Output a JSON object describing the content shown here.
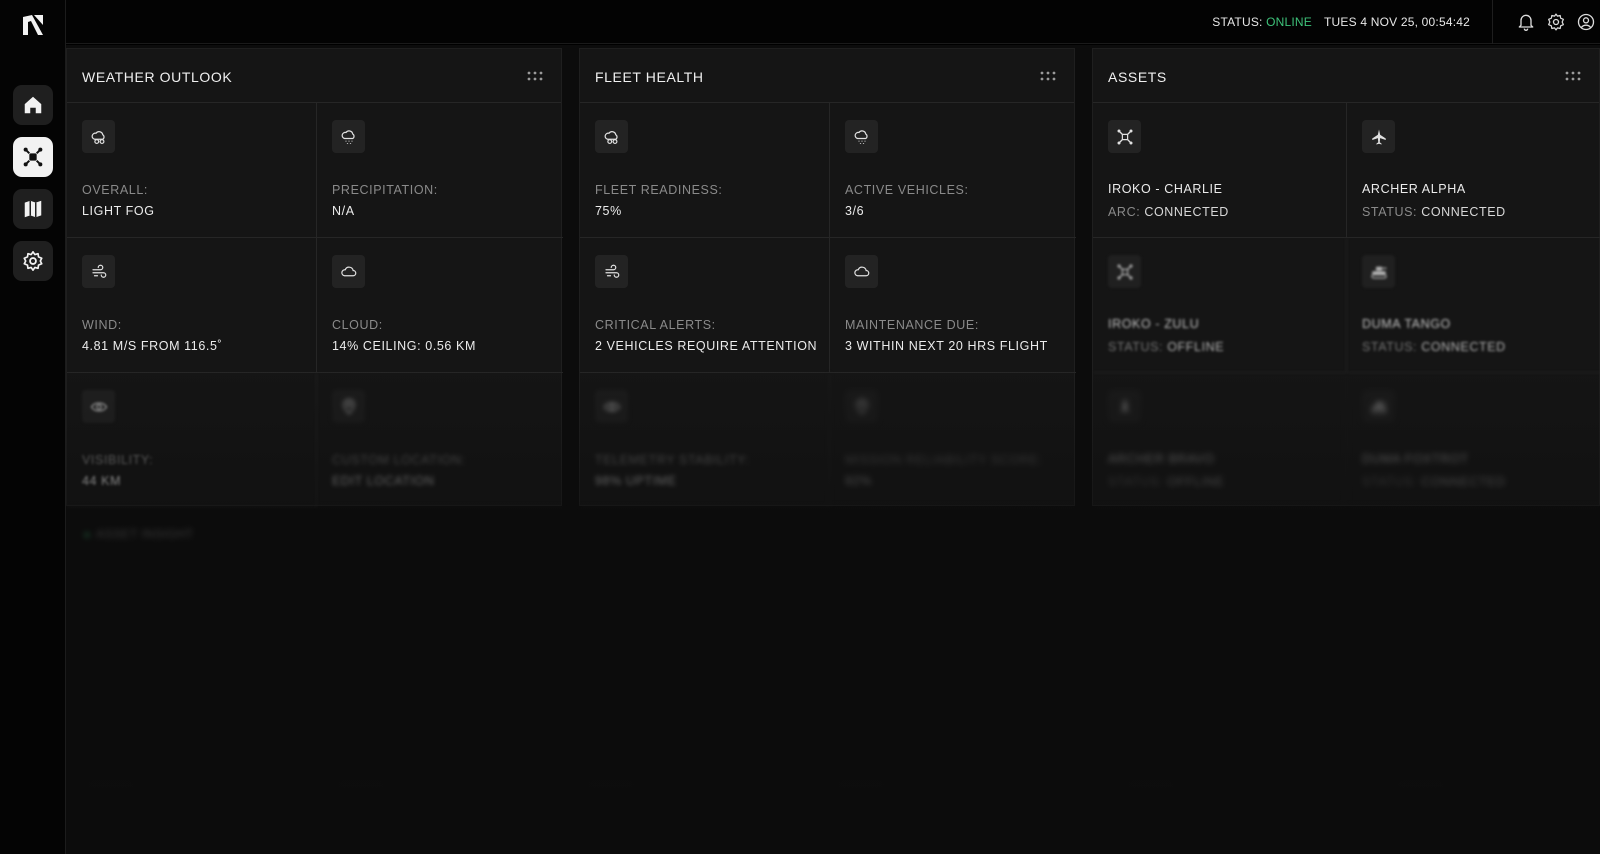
{
  "topbar": {
    "status_label": "STATUS:",
    "status_value": "ONLINE",
    "datetime": "TUES 4 NOV 25, 00:54:42"
  },
  "sidebar": {
    "items": [
      {
        "icon": "home-icon"
      },
      {
        "icon": "drone-icon",
        "active": true
      },
      {
        "icon": "map-icon"
      },
      {
        "icon": "gear-icon"
      }
    ]
  },
  "weather": {
    "title": "WEATHER OUTLOOK",
    "cells": [
      {
        "icon": "cloud-sun-icon",
        "label": "OVERALL:",
        "value": "LIGHT FOG"
      },
      {
        "icon": "cloud-rain-icon",
        "label": "PRECIPITATION:",
        "value": "N/A"
      },
      {
        "icon": "wind-icon",
        "label": "WIND:",
        "value": "4.81 M/S FROM 116.5˚"
      },
      {
        "icon": "cloud-icon",
        "label": "CLOUD:",
        "value": "14% CEILING: 0.56 KM"
      },
      {
        "icon": "eye-icon",
        "label": "VISIBILITY:",
        "value": "44 KM"
      },
      {
        "icon": "pin-icon",
        "label": "CUSTOM LOCATION:",
        "value": "EDIT LOCATION"
      }
    ]
  },
  "fleet": {
    "title": "FLEET HEALTH",
    "cells": [
      {
        "icon": "cloud-sun-icon",
        "label": "FLEET READINESS:",
        "value": "75%"
      },
      {
        "icon": "cloud-rain-icon",
        "label": "ACTIVE VEHICLES:",
        "value": "3/6"
      },
      {
        "icon": "wind-icon",
        "label": "CRITICAL ALERTS:",
        "value": "2 VEHICLES REQUIRE ATTENTION"
      },
      {
        "icon": "cloud-icon",
        "label": "MAINTENANCE DUE:",
        "value": "3 WITHIN NEXT 20 HRS FLIGHT"
      },
      {
        "icon": "eye-icon",
        "label": "TELEMETRY STABILITY:",
        "value": "98% UPTIME"
      },
      {
        "icon": "pin-icon",
        "label": "MISSION RELIABILITY SCORE:",
        "value": "92%"
      }
    ]
  },
  "assets": {
    "title": "ASSETS",
    "cells": [
      {
        "icon": "drone-icon",
        "name": "IROKO - CHARLIE",
        "status_label": "ARC:",
        "status_value": "CONNECTED"
      },
      {
        "icon": "jet-icon",
        "name": "ARCHER ALPHA",
        "status_label": "STATUS:",
        "status_value": "CONNECTED"
      },
      {
        "icon": "drone-icon",
        "name": "IROKO - ZULU",
        "status_label": "STATUS:",
        "status_value": "OFFLINE"
      },
      {
        "icon": "tank-icon",
        "name": "DUMA TANGO",
        "status_label": "STATUS:",
        "status_value": "CONNECTED"
      },
      {
        "icon": "rocket-icon",
        "name": "ARCHER BRAVO",
        "status_label": "STATUS:",
        "status_value": "OFFLINE"
      },
      {
        "icon": "tank-icon",
        "name": "DUMA FOXTROT",
        "status_label": "STATUS:",
        "status_value": "CONNECTED"
      }
    ]
  },
  "lower": {
    "title": "ASSET INSIGHT"
  }
}
